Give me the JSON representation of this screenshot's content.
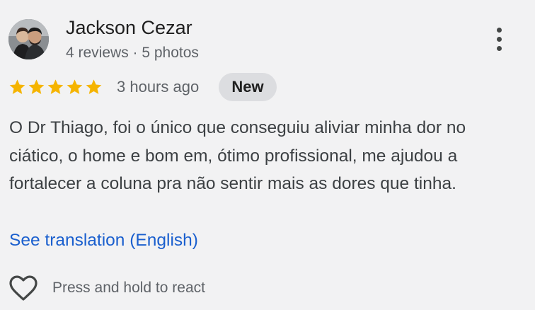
{
  "review": {
    "author": {
      "name": "Jackson Cezar",
      "meta": "4 reviews · 5 photos"
    },
    "rating": 5,
    "star_color": "#f5b400",
    "time_ago": "3 hours ago",
    "badge": "New",
    "text": "O Dr Thiago, foi o único que conseguiu aliviar minha dor no ciático, o home e bom em, ótimo profissional, me ajudou a fortalecer a coluna pra não sentir mais as dores que tinha.",
    "translate_link": "See translation (English)",
    "react_label": "Press and hold to react"
  },
  "icons": {
    "menu": "more-vert-icon",
    "star": "star-icon",
    "react": "heart-icon"
  },
  "colors": {
    "background": "#f2f2f3",
    "link": "#1a5fce",
    "badge_bg": "#dcdde0",
    "secondary_text": "#5f6368"
  }
}
